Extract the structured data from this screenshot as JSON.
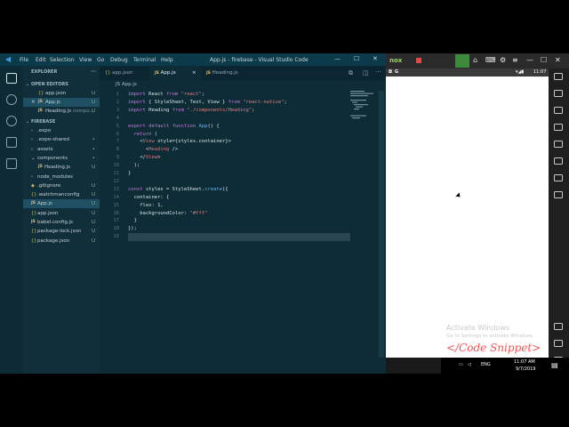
{
  "window": {
    "title": "App.js - firebase - Visual Studio Code",
    "menu": [
      "File",
      "Edit",
      "Selection",
      "View",
      "Go",
      "Debug",
      "Terminal",
      "Help"
    ]
  },
  "sidebar": {
    "explorer_label": "EXPLORER",
    "open_editors_label": "OPEN EDITORS",
    "open_editors": [
      {
        "icon": "{}",
        "name": "app.json",
        "badge": "U"
      },
      {
        "icon": "JS",
        "name": "App.js",
        "badge": "U",
        "close": "✕"
      },
      {
        "icon": "JS",
        "name": "Heading.js",
        "hint": "compo...",
        "badge": "U"
      }
    ],
    "project_label": "FIREBASE",
    "tree": [
      {
        "name": ".expo",
        "arrow": "›",
        "badge": ""
      },
      {
        "name": ".expo-shared",
        "arrow": "›",
        "badge": "•"
      },
      {
        "name": "assets",
        "arrow": "›",
        "badge": "•"
      },
      {
        "name": "components",
        "arrow": "⌄",
        "badge": "•"
      },
      {
        "name": "Heading.js",
        "icon": "JS",
        "badge": "U"
      },
      {
        "name": "node_modules",
        "arrow": "›",
        "badge": ""
      },
      {
        "name": ".gitignore",
        "icon": "◆",
        "badge": "U"
      },
      {
        "name": ".watchmanconfig",
        "icon": "{}",
        "badge": "U"
      },
      {
        "name": "App.js",
        "icon": "JS",
        "badge": "U"
      },
      {
        "name": "app.json",
        "icon": "{}",
        "badge": "U"
      },
      {
        "name": "babel.config.js",
        "icon": "JS",
        "badge": "U"
      },
      {
        "name": "package-lock.json",
        "icon": "{}",
        "badge": "U"
      },
      {
        "name": "package.json",
        "icon": "{}",
        "badge": "U"
      }
    ]
  },
  "tabs": [
    {
      "icon": "{}",
      "label": "app.json"
    },
    {
      "icon": "JS",
      "label": "App.js",
      "close": "×"
    },
    {
      "icon": "JS",
      "label": "Heading.js"
    }
  ],
  "breadcrumb": "JS App.js",
  "code_lines": [
    "import React from \"react\";",
    "import { StyleSheet, Text, View } from \"react-native\";",
    "import Heading from \"./components/Heading\";",
    "",
    "export default function App() {",
    "  return (",
    "    <View style={styles.container}>",
    "      <Heading />",
    "    </View>",
    "  );",
    "}",
    "",
    "const styles = StyleSheet.create({",
    "  container: {",
    "    flex: 1,",
    "    backgroundColor: \"#fff\"",
    "  }",
    "});",
    ""
  ],
  "emulator": {
    "brand": "nox",
    "status_time": "11:07",
    "watermark_title": "Activate Windows",
    "watermark_sub": "Go to Settings to activate Windows.",
    "overlay": "</Code Snippet>",
    "taskbar_lang": "ENG",
    "taskbar_time": "11:07 AM",
    "taskbar_date": "9/7/2019"
  },
  "colors": {
    "accent": "#0b3a4a",
    "highlight": "#1f4f62",
    "badge": "#7fb98a",
    "js_icon": "#e5c07b"
  }
}
